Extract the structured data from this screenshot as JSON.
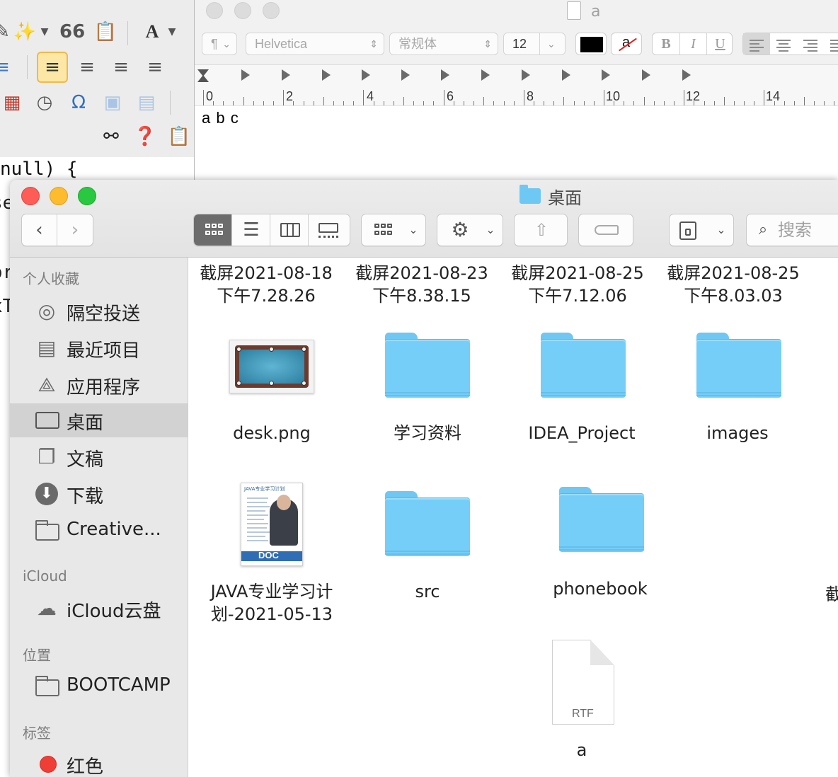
{
  "ide": {
    "code_line": "null) {",
    "peek_chars": [
      "se",
      "or",
      "xT"
    ]
  },
  "textedit": {
    "title": "a",
    "paragraph_style": "¶",
    "font_family": "Helvetica",
    "font_style": "常规体",
    "font_size": "12",
    "style_buttons": [
      "B",
      "I",
      "U"
    ],
    "ruler_numbers": [
      "0",
      "2",
      "4",
      "6",
      "8",
      "10",
      "12",
      "14"
    ],
    "body_text": "a b c",
    "text_color": "#000000"
  },
  "finder": {
    "title": "桌面",
    "search_placeholder": "搜索",
    "sidebar": {
      "favorites_header": "个人收藏",
      "favorites": [
        {
          "label": "隔空投送",
          "icon": "airdrop-icon"
        },
        {
          "label": "最近项目",
          "icon": "recents-icon"
        },
        {
          "label": "应用程序",
          "icon": "applications-icon"
        },
        {
          "label": "桌面",
          "icon": "desktop-icon",
          "selected": true
        },
        {
          "label": "文稿",
          "icon": "documents-icon"
        },
        {
          "label": "下载",
          "icon": "downloads-icon"
        },
        {
          "label": "Creative...",
          "icon": "folder-icon"
        }
      ],
      "icloud_header": "iCloud",
      "icloud_items": [
        {
          "label": "iCloud云盘",
          "icon": "cloud-icon"
        }
      ],
      "locations_header": "位置",
      "locations": [
        {
          "label": "BOOTCAMP",
          "icon": "drive-icon"
        }
      ],
      "tags_header": "标签",
      "tags": [
        {
          "label": "红色",
          "color": "#ef3e36"
        }
      ]
    },
    "top_row_labels": [
      {
        "line1": "截屏2021-08-18",
        "line2": "下午7.28.26"
      },
      {
        "line1": "截屏2021-08-23",
        "line2": "下午8.38.15"
      },
      {
        "line1": "截屏2021-08-25",
        "line2": "下午7.12.06"
      },
      {
        "line1": "截屏2021-08-25",
        "line2": "下午8.03.03"
      }
    ],
    "items": [
      {
        "name": "desk.png",
        "kind": "image"
      },
      {
        "name": "学习资料",
        "kind": "folder"
      },
      {
        "name": "IDEA_Project",
        "kind": "folder"
      },
      {
        "name": "images",
        "kind": "folder"
      },
      {
        "name": "JAVA专业学习计",
        "name2": "划-2021-05-13",
        "kind": "doc"
      },
      {
        "name": "src",
        "kind": "folder"
      },
      {
        "name": "phonebook",
        "kind": "folder"
      },
      {
        "name": "a",
        "kind": "rtf"
      }
    ],
    "doc_badge": "DOC",
    "doc_header": "JAVA专业学习计划",
    "rtf_badge": "RTF",
    "partial_label": "截"
  }
}
